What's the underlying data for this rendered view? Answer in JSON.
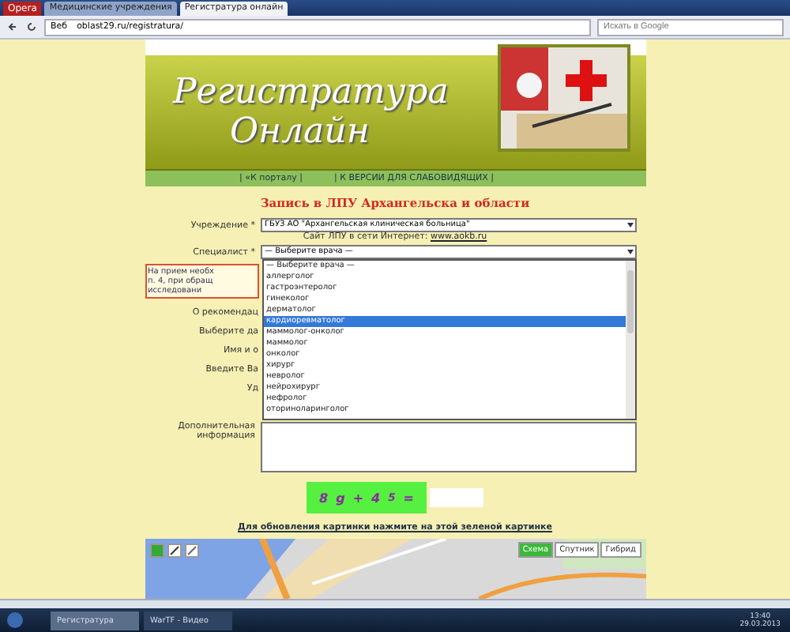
{
  "browser": {
    "menu_label": "Opera",
    "tabs": [
      {
        "label": "Медицинские учреждения",
        "selected": false
      },
      {
        "label": "Регистратура онлайн",
        "selected": true
      }
    ],
    "address_prefix": "Веб",
    "address": "oblast29.ru/registratura/",
    "search": {
      "placeholder": "Искать в Google"
    }
  },
  "header": {
    "title_line1": "Регистратура",
    "title_line2": "Онлайн",
    "nav": [
      "| «К порталу |",
      "| К ВЕРСИИ ДЛЯ СЛАБОВИДЯЩИХ |"
    ]
  },
  "heading": "Запись в ЛПУ Архангельска и области",
  "form": {
    "institution": {
      "label": "Учреждение *",
      "value": "ГБУЗ АО \"Архангельская клиническая больница\""
    },
    "site": {
      "label": "Сайт ЛПУ в сети Интернет:",
      "link": "www.aokb.ru"
    },
    "specialist": {
      "label": "Специалист *",
      "value": "— Выберите врача —"
    },
    "notice": [
      "На прием необх",
      "п. 4, при обращ",
      "исследовани"
    ],
    "recommend": "О рекомендац",
    "labels": [
      "Выберите да",
      "Имя и о",
      "Введите Ва",
      "Уд"
    ],
    "extra_label": "Дополнительная информация",
    "options": [
      {
        "label": "— Выберите врача —",
        "selected": false
      },
      {
        "label": "аллерголог",
        "selected": false
      },
      {
        "label": "гастроэнтеролог",
        "selected": false
      },
      {
        "label": "гинеколог",
        "selected": false
      },
      {
        "label": "дерматолог",
        "selected": false
      },
      {
        "label": "кардиоревматолог",
        "selected": true
      },
      {
        "label": "маммолог-онколог",
        "selected": false
      },
      {
        "label": "маммолог",
        "selected": false
      },
      {
        "label": "онколог",
        "selected": false
      },
      {
        "label": "хирург",
        "selected": false
      },
      {
        "label": "невролог",
        "selected": false
      },
      {
        "label": "нейрохирург",
        "selected": false
      },
      {
        "label": "нефролог",
        "selected": false
      },
      {
        "label": "оториноларинголог",
        "selected": false
      }
    ]
  },
  "captcha": {
    "parts": [
      "8",
      "g",
      "+",
      "4"
    ],
    "power": "5",
    "equals": "=",
    "refresh_link": "Для обновления картинки нажмите на этой зеленой картинке"
  },
  "map": {
    "buttons": [
      {
        "label": "Схема",
        "selected": true
      },
      {
        "label": "Спутник",
        "selected": false
      },
      {
        "label": "Гибрид",
        "selected": false
      }
    ]
  },
  "taskbar": {
    "items": [
      {
        "label": "Регистратура",
        "selected": true
      },
      {
        "label": "WarTF - Видео",
        "selected": false
      }
    ],
    "time": "13:40",
    "date": "29.03.2013"
  }
}
